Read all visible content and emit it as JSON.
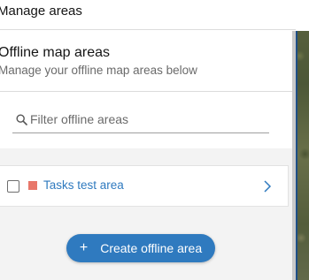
{
  "header": {
    "title": "Manage areas"
  },
  "section": {
    "title": "Offline map areas",
    "description": "Manage your offline map areas below"
  },
  "filter": {
    "placeholder": "Filter offline areas",
    "icon": "search-icon"
  },
  "areas": [
    {
      "label": "Tasks test area",
      "checked": false,
      "color": "#e8776a"
    }
  ],
  "actions": {
    "create_label": "Create offline area",
    "create_icon": "plus-icon"
  },
  "colors": {
    "accent": "#2f7abf",
    "link": "#2f7abf",
    "text": "#151515",
    "muted": "#6a6a6a",
    "background": "#f3f3f3"
  }
}
